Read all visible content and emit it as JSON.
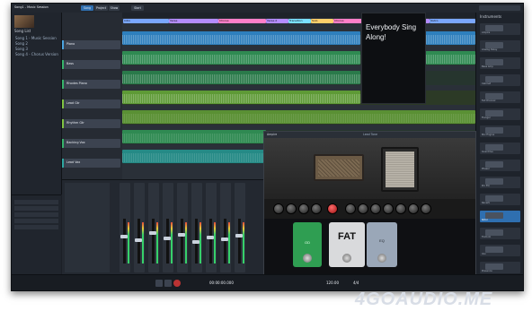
{
  "window": {
    "title": "Song1 - Music Session"
  },
  "toolbar": {
    "song_btn": "Song",
    "project_btn": "Project",
    "show_btn": "Show",
    "buttons": [
      "Song",
      "Project",
      "Show",
      "Start"
    ]
  },
  "browser": {
    "header": "Song List",
    "items": [
      "Song 1 - Music Session",
      "Song 2",
      "Song 3",
      "Song 4 - Chorus Version"
    ]
  },
  "tracks": [
    {
      "name": "Piano",
      "color": "#4aa3df"
    },
    {
      "name": "Bass",
      "color": "#36b36a"
    },
    {
      "name": "Rhodes Piano",
      "color": "#36b36a"
    },
    {
      "name": "Lead Gtr",
      "color": "#7fc241"
    },
    {
      "name": "Rhythm Gtr",
      "color": "#7fc241"
    },
    {
      "name": "Backing Vox",
      "color": "#36b36a"
    },
    {
      "name": "Lead Vox",
      "color": "#2ea6a0"
    }
  ],
  "arrange": {
    "markers": [
      {
        "label": "Intro",
        "color": "#7aa7ff"
      },
      {
        "label": "Verse",
        "color": "#b48cff"
      },
      {
        "label": "Chorus",
        "color": "#ff7fc8"
      },
      {
        "label": "Verse 2",
        "color": "#b48cff"
      },
      {
        "label": "Transition",
        "color": "#7ae0ff"
      },
      {
        "label": "Solo",
        "color": "#ffcf6a"
      },
      {
        "label": "Chorus",
        "color": "#ff7fc8"
      },
      {
        "label": "Verse 3",
        "color": "#b48cff"
      },
      {
        "label": "Outro",
        "color": "#7aa7ff"
      }
    ],
    "lyric_text": "Everybody Sing Along!"
  },
  "right_panel": {
    "title": "Instruments",
    "items": [
      "Ampire",
      "Analog Delay",
      "Bass Amp",
      "Cabinet",
      "Fat Channel",
      "Flanger",
      "Mix Engine",
      "Overdrive",
      "Phaser",
      "Pro EQ",
      "Reverb",
      "Rotor",
      "Tremolo",
      "Vox",
      "Presence"
    ]
  },
  "plugin": {
    "title": "Ampire",
    "preset": "Lead Tone",
    "pedal_labels": [
      "OD",
      "FAT",
      "EQ"
    ]
  },
  "transport": {
    "time": "00:00:00.000",
    "bpm": "120.00",
    "signature": "4/4"
  },
  "watermark": "4GOAUDIO.ME"
}
